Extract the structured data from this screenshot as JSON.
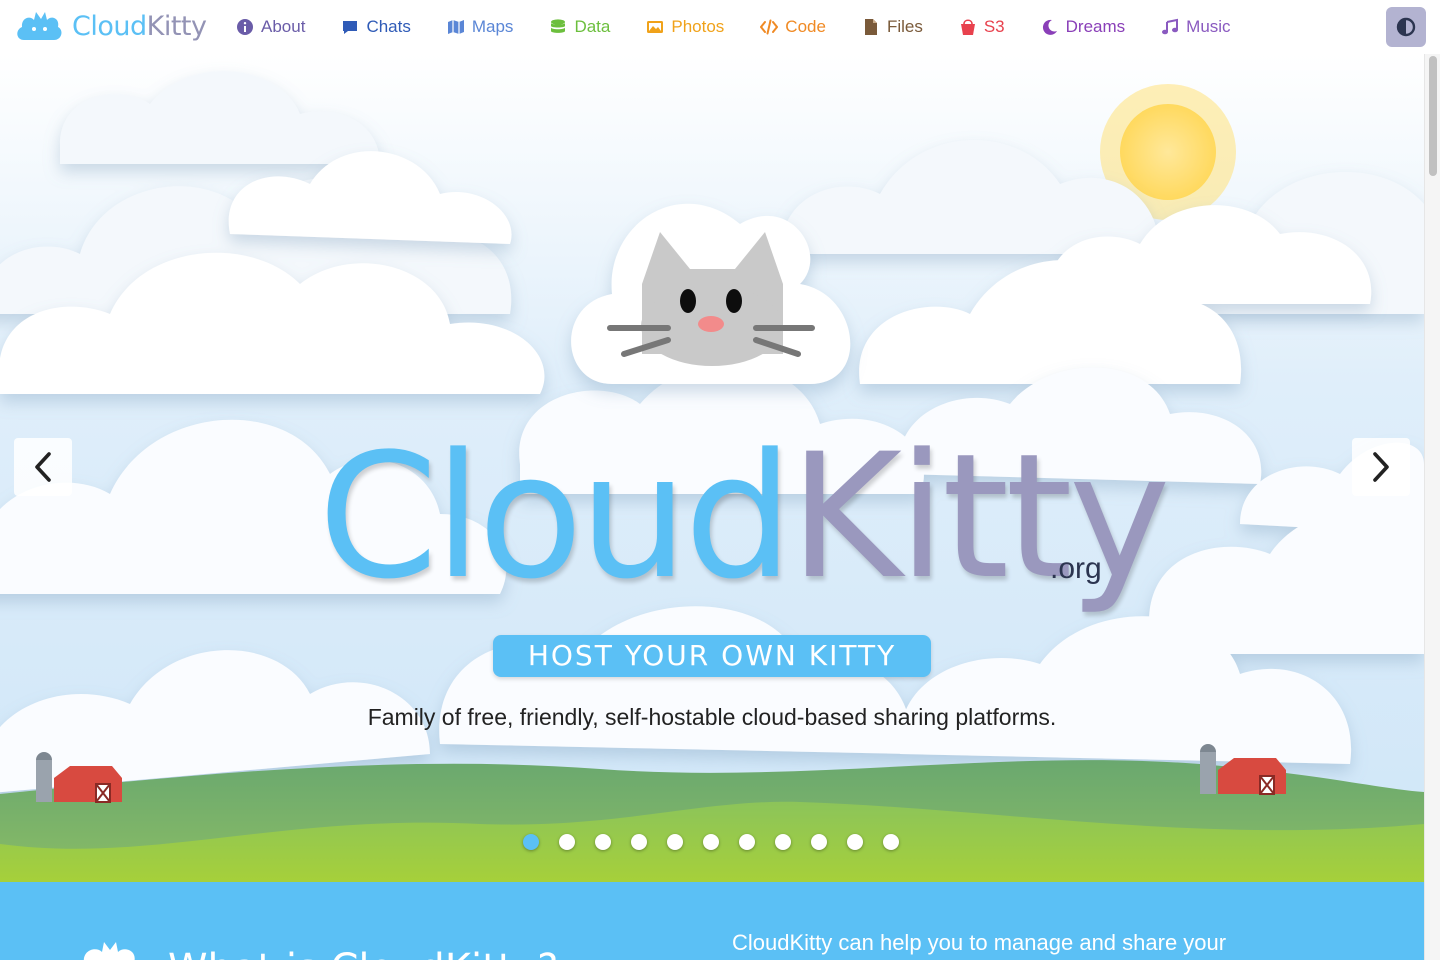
{
  "brand": {
    "part1": "Cloud",
    "part2": "Kitty"
  },
  "nav": [
    {
      "id": "about",
      "label": "About",
      "icon": "info-circle-icon",
      "color": "#6a5ca8"
    },
    {
      "id": "chats",
      "label": "Chats",
      "icon": "chat-bubble-icon",
      "color": "#2f5bb7"
    },
    {
      "id": "maps",
      "label": "Maps",
      "icon": "map-icon",
      "color": "#5a86d6"
    },
    {
      "id": "data",
      "label": "Data",
      "icon": "database-icon",
      "color": "#6cbf3d"
    },
    {
      "id": "photos",
      "label": "Photos",
      "icon": "image-icon",
      "color": "#f0a21a"
    },
    {
      "id": "code",
      "label": "Code",
      "icon": "code-icon",
      "color": "#f08a24"
    },
    {
      "id": "files",
      "label": "Files",
      "icon": "file-icon",
      "color": "#7a5a3a"
    },
    {
      "id": "s3",
      "label": "S3",
      "icon": "bucket-icon",
      "color": "#e8414d"
    },
    {
      "id": "dreams",
      "label": "Dreams",
      "icon": "moon-icon",
      "color": "#8a3fb8"
    },
    {
      "id": "music",
      "label": "Music",
      "icon": "music-note-icon",
      "color": "#8a5ac0"
    }
  ],
  "theme_toggle": {
    "icon": "contrast-icon"
  },
  "hero": {
    "title_cloud": "Cloud",
    "title_kitty": "Kitty",
    "title_suffix": ".org",
    "tagline": "HOST YOUR OWN KITTY",
    "subtitle": "Family of free, friendly, self-hostable cloud-based sharing platforms.",
    "slide_count": 11,
    "active_slide": 1,
    "prev_icon": "chevron-left-icon",
    "next_icon": "chevron-right-icon"
  },
  "about": {
    "title": "What is CloudKitty?",
    "text": "CloudKitty can help you to manage and share your"
  },
  "colors": {
    "sky_blue": "#5bc0f5",
    "lavender": "#9a98be",
    "grass": "#8ec654"
  }
}
